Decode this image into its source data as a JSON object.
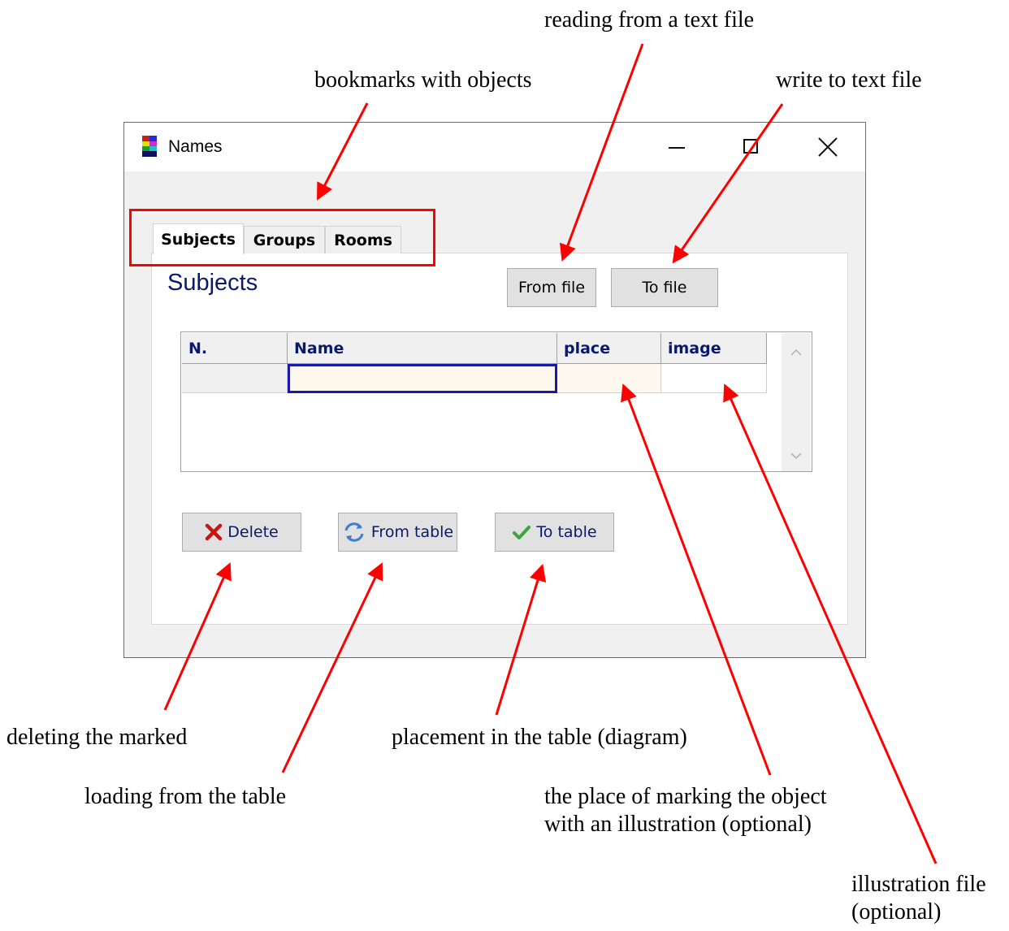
{
  "window": {
    "title": "Names",
    "controls": [
      "minimize-icon",
      "maximize-icon",
      "close-icon"
    ]
  },
  "tabs": [
    {
      "label": "Subjects",
      "active": true
    },
    {
      "label": "Groups",
      "active": false
    },
    {
      "label": "Rooms",
      "active": false
    }
  ],
  "panel": {
    "section_title": "Subjects",
    "from_file_label": "From file",
    "to_file_label": "To file"
  },
  "grid": {
    "columns": [
      "N.",
      "Name",
      "place",
      "image"
    ],
    "rows": [
      [
        "",
        "",
        "",
        ""
      ]
    ]
  },
  "actions": {
    "delete_label": "Delete",
    "from_table_label": "From table",
    "to_table_label": "To table"
  },
  "annotations": {
    "reading_from_file": "reading from a text file",
    "bookmarks": "bookmarks with objects",
    "write_to_file": "write to text file",
    "deleting": "deleting the marked",
    "placement": "placement in the table (diagram)",
    "loading": "loading from the table",
    "place_marking": "the place of marking the object with an illustration (optional)",
    "illustration_file": "illustration file (optional)"
  },
  "colors": {
    "annotation_arrow": "#ff0000",
    "label_text": "#0a1a6b",
    "cell_highlight": "#fff8ee",
    "active_cell_border": "#1a1aa8"
  }
}
